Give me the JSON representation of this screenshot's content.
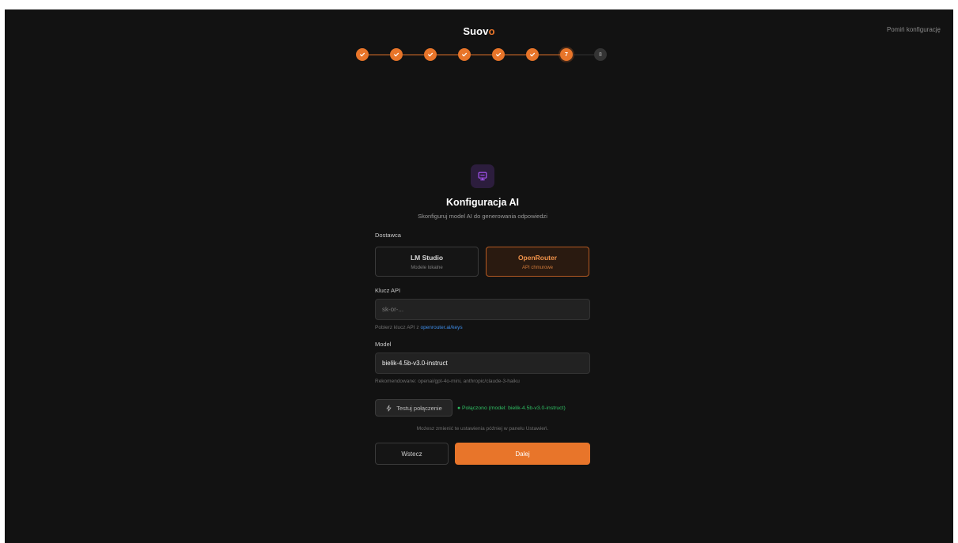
{
  "header": {
    "brand_main": "Suov",
    "brand_accent": "o",
    "skip_label": "Pomiń konfigurację"
  },
  "stepper": {
    "current_step": 7,
    "total_steps": 8,
    "steps": [
      {
        "state": "done",
        "label": "",
        "icon": "check-icon"
      },
      {
        "state": "done",
        "label": "",
        "icon": "check-icon"
      },
      {
        "state": "done",
        "label": "",
        "icon": "check-icon"
      },
      {
        "state": "done",
        "label": "",
        "icon": "check-icon"
      },
      {
        "state": "done",
        "label": "",
        "icon": "check-icon"
      },
      {
        "state": "done",
        "label": "",
        "icon": "check-icon"
      },
      {
        "state": "current",
        "label": "7"
      },
      {
        "state": "todo",
        "label": "8"
      }
    ]
  },
  "card": {
    "icon": "monitor-icon",
    "title": "Konfiguracja AI",
    "subtitle": "Skonfiguruj model AI do generowania odpowiedzi",
    "provider_label": "Dostawca",
    "providers": [
      {
        "name": "LM Studio",
        "sub": "Modele lokalne",
        "selected": false
      },
      {
        "name": "OpenRouter",
        "sub": "API chmurowe",
        "selected": true
      }
    ],
    "api_key": {
      "label": "Klucz API",
      "placeholder": "sk-or-...",
      "value": "",
      "hint_prefix": "Pobierz klucz API z ",
      "hint_link": "openrouter.ai/keys"
    },
    "model": {
      "label": "Model",
      "value": "bielik-4.5b-v3.0-instruct",
      "hint": "Rekomendowane: openai/gpt-4o-mini, anthropic/claude-3-haiku"
    },
    "test_button": {
      "icon": "zap-icon",
      "label": "Testuj połączenie"
    },
    "status": "● Połączono (model: bielik-4.5b-v3.0-instruct)",
    "note": "Możesz zmienić te ustawienia później w panelu Ustawień.",
    "back_label": "Wstecz",
    "next_label": "Dalej"
  },
  "colors": {
    "accent": "#e8752a",
    "background": "#121212",
    "success": "#2fbf63",
    "link": "#3d8ce8",
    "icon_purple": "#a855f7"
  }
}
